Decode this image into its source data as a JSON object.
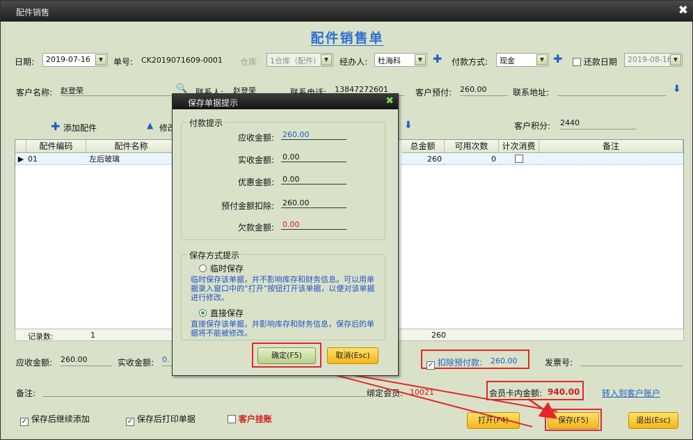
{
  "window": {
    "title": "配件销售",
    "close_glyph": "✖"
  },
  "form_title": "配件销售单",
  "row1": {
    "date_label": "日期:",
    "date_value": "2019-07-16",
    "order_no_label": "单号:",
    "order_no_value": "CK2019071609-0001",
    "warehouse_label": "仓库:",
    "warehouse_value": "1仓库（配件）",
    "agent_label": "经办人:",
    "agent_value": "杜海科",
    "pay_label": "付款方式:",
    "pay_value": "现金",
    "repay_label": "还款日期",
    "repay_value": "2019-08-16"
  },
  "row2": {
    "customer_label": "客户名称:",
    "customer_value": "赵登荣",
    "contact_label": "联系人:",
    "contact_value": "赵登荣",
    "phone_label": "联系电话:",
    "phone_value": "13847272601",
    "prepay_label": "客户预付:",
    "prepay_value": "260.00",
    "address_label": "联系地址:",
    "address_value": ""
  },
  "toolbar": {
    "add_label": "添加配件",
    "modify_label": "修改",
    "points_label": "客户积分:",
    "points_value": "2440"
  },
  "grid": {
    "headers": {
      "code": "配件编码",
      "name": "配件名称",
      "total": "总金额",
      "usable": "可用次数",
      "count_consume": "计次消费",
      "remark": "备注"
    },
    "row": {
      "code": "01",
      "name": "左后玻璃",
      "total": "260",
      "usable": "0"
    },
    "footer": {
      "count_label": "记录数:",
      "count_value": "1",
      "total_value": "260"
    }
  },
  "summary": {
    "receivable_label": "应收金额:",
    "receivable_value": "260.00",
    "actual_label": "实收金额:",
    "actual_value": "0.",
    "deduct_label": "扣除预付款:",
    "deduct_value": "260.00",
    "invoice_label": "发票号:",
    "remark_label": "备注:",
    "member_label": "绑定会员:",
    "member_value": "10021",
    "card_label": "会员卡内金额:",
    "card_value": "940.00",
    "transfer_link": "转入到客户账户"
  },
  "bottom": {
    "continue_label": "保存后继续添加",
    "print_label": "保存后打印单据",
    "credit_label": "客户挂账",
    "open_btn": "打开(F4)",
    "save_btn": "保存(F5)",
    "exit_btn": "退出(Esc)"
  },
  "dialog": {
    "title": "保存单据提示",
    "close_glyph": "✖",
    "pay_group": "付款提示",
    "receivable_label": "应收金额:",
    "receivable_value": "260.00",
    "actual_label": "实收金额:",
    "actual_value": "0.00",
    "discount_label": "优惠金额:",
    "discount_value": "0.00",
    "prepay_deduct_label": "预付金额扣除:",
    "prepay_deduct_value": "260.00",
    "debt_label": "欠款金额:",
    "debt_value": "0.00",
    "save_group": "保存方式提示",
    "temp_label": "临时保存",
    "temp_note": "临时保存该单据，并不影响库存和财务信息。可以用单据录入窗口中的“打开”按钮打开该单据，以便对该单据进行修改。",
    "direct_label": "直接保存",
    "direct_note": "直接保存该单据，并影响库存和财务信息，保存后的单据将不能被修改。",
    "ok_btn": "确定(F5)",
    "cancel_btn": "取消(Esc)"
  },
  "colors": {
    "accent_blue": "#2d6fd0",
    "highlight_red": "#e3262a",
    "button_yellow": "#f6b51a"
  }
}
